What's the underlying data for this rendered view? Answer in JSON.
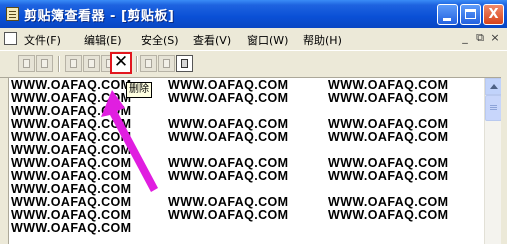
{
  "window": {
    "title": "剪贴簿查看器 - [剪贴板]",
    "minimize_icon": "minimize-icon",
    "maximize_icon": "maximize-icon",
    "close_label": "X"
  },
  "menubar": {
    "items": [
      {
        "label": "文件(F)"
      },
      {
        "label": "编辑(E)"
      },
      {
        "label": "安全(S)"
      },
      {
        "label": "查看(V)"
      },
      {
        "label": "窗口(W)"
      },
      {
        "label": "帮助(H)"
      }
    ],
    "mdi_minimize": "_",
    "mdi_restore": "⧉",
    "mdi_close": "×"
  },
  "toolbar": {
    "delete_symbol": "✕",
    "delete_tooltip": "删除",
    "highlight_color": "#E2161E"
  },
  "content": {
    "cell_text": "WWW.OAFAQ.COM",
    "rows": [
      [
        "WWW.OAFAQ.COM",
        "WWW.OAFAQ.COM",
        "WWW.OAFAQ.COM"
      ],
      [
        "WWW.OAFAQ.COM",
        "WWW.OAFAQ.COM",
        "WWW.OAFAQ.COM"
      ],
      [
        "WWW.OAFAQ.COM"
      ],
      [
        "WWW.OAFAQ.COM",
        "WWW.OAFAQ.COM",
        "WWW.OAFAQ.COM"
      ],
      [
        "WWW.OAFAQ.COM",
        "WWW.OAFAQ.COM",
        "WWW.OAFAQ.COM"
      ],
      [
        "WWW.OAFAQ.COM"
      ],
      [
        "WWW.OAFAQ.COM",
        "WWW.OAFAQ.COM",
        "WWW.OAFAQ.COM"
      ],
      [
        "WWW.OAFAQ.COM",
        "WWW.OAFAQ.COM",
        "WWW.OAFAQ.COM"
      ],
      [
        "WWW.OAFAQ.COM"
      ],
      [
        "WWW.OAFAQ.COM",
        "WWW.OAFAQ.COM",
        "WWW.OAFAQ.COM"
      ],
      [
        "WWW.OAFAQ.COM",
        "WWW.OAFAQ.COM",
        "WWW.OAFAQ.COM"
      ],
      [
        "WWW.OAFAQ.COM"
      ]
    ]
  },
  "annotation": {
    "arrow_color": "#E01EE0"
  }
}
